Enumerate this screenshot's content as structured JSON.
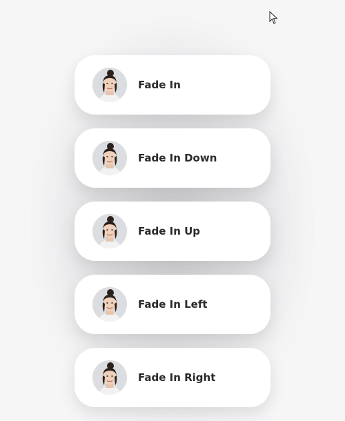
{
  "items": [
    {
      "label": "Fade In"
    },
    {
      "label": "Fade In Down"
    },
    {
      "label": "Fade In Up"
    },
    {
      "label": "Fade In Left"
    },
    {
      "label": "Fade In Right"
    }
  ],
  "icons": {
    "avatar": "avatar-photo",
    "cursor": "mouse-pointer-icon"
  }
}
